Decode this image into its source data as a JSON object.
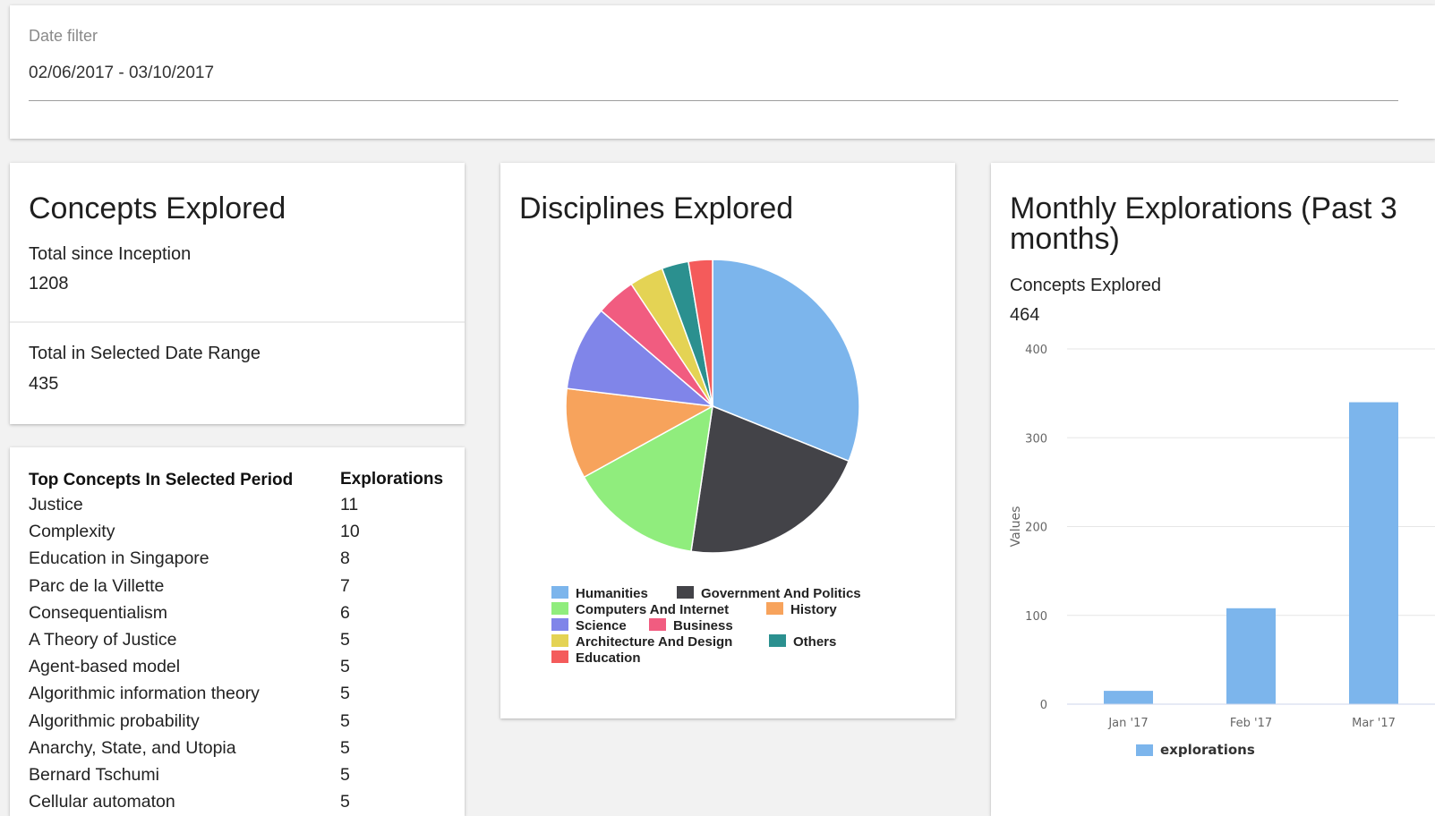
{
  "date_filter": {
    "label": "Date filter",
    "value": "02/06/2017 - 03/10/2017"
  },
  "concepts_card": {
    "title": "Concepts Explored",
    "total_label": "Total since Inception",
    "total_value": "1208",
    "range_label": "Total in Selected Date Range",
    "range_value": "435"
  },
  "top_concepts": {
    "header_concept": "Top Concepts In Selected Period",
    "header_explorations": "Explorations",
    "rows": [
      {
        "name": "Justice",
        "count": "11"
      },
      {
        "name": "Complexity",
        "count": "10"
      },
      {
        "name": "Education in Singapore",
        "count": "8"
      },
      {
        "name": "Parc de la Villette",
        "count": "7"
      },
      {
        "name": "Consequentialism",
        "count": "6"
      },
      {
        "name": "A Theory of Justice",
        "count": "5"
      },
      {
        "name": "Agent-based model",
        "count": "5"
      },
      {
        "name": "Algorithmic information theory",
        "count": "5"
      },
      {
        "name": "Algorithmic probability",
        "count": "5"
      },
      {
        "name": "Anarchy, State, and Utopia",
        "count": "5"
      },
      {
        "name": "Bernard Tschumi",
        "count": "5"
      },
      {
        "name": "Cellular automaton",
        "count": "5"
      }
    ]
  },
  "disciplines_card": {
    "title": "Disciplines Explored"
  },
  "monthly_card": {
    "title_line1": "Monthly Explorations (Past 3",
    "title_line2": "months)",
    "stat_label": "Concepts Explored",
    "stat_value": "464"
  },
  "chart_data": [
    {
      "type": "pie",
      "categories": [
        "Humanities",
        "Government And Politics",
        "Computers And Internet",
        "History",
        "Science",
        "Business",
        "Architecture And Design",
        "Others",
        "Education"
      ],
      "values": [
        30.6,
        20.9,
        14.4,
        9.8,
        9.2,
        4.3,
        3.7,
        2.9,
        2.6
      ],
      "colors": [
        "#7cb5ec",
        "#434348",
        "#90ed7d",
        "#f7a35c",
        "#8085e9",
        "#f15c80",
        "#e4d354",
        "#2b908f",
        "#f45b5b"
      ],
      "legend_position": "bottom"
    },
    {
      "type": "bar",
      "categories": [
        "Jan '17",
        "Feb '17",
        "Mar '17"
      ],
      "series": [
        {
          "name": "explorations",
          "values": [
            15,
            108,
            340
          ],
          "color": "#7cb5ec"
        }
      ],
      "ylabel": "Values",
      "ylim": [
        0,
        400
      ],
      "yticks": [
        0,
        100,
        200,
        300,
        400
      ],
      "grid": true,
      "legend_position": "bottom"
    }
  ]
}
